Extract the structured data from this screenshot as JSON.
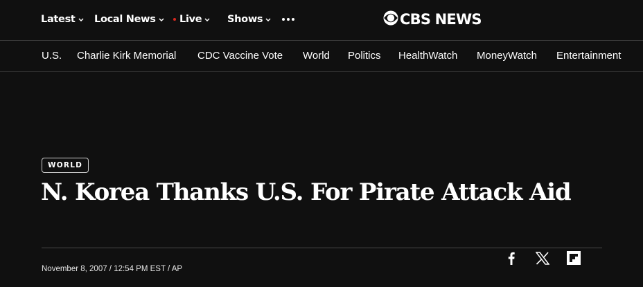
{
  "top_nav": {
    "latest": "Latest",
    "local_news": "Local News",
    "live": "Live",
    "shows": "Shows",
    "live_dot_color": "#d8281f",
    "more_icon": "more-dots-icon"
  },
  "logo": {
    "text": "CBS NEWS",
    "icon": "cbs-eye-icon"
  },
  "sub_nav": [
    "U.S.",
    "Charlie Kirk Memorial",
    "CDC Vaccine Vote",
    "World",
    "Politics",
    "HealthWatch",
    "MoneyWatch",
    "Entertainment"
  ],
  "article": {
    "category": "WORLD",
    "headline": "N. Korea Thanks U.S. For Pirate Attack Aid",
    "byline": "November 8, 2007 / 12:54 PM EST / AP"
  },
  "share": {
    "facebook": "facebook-icon",
    "x": "x-icon",
    "flipboard": "flipboard-icon"
  },
  "colors": {
    "background": "#101010",
    "text": "#ffffff"
  }
}
